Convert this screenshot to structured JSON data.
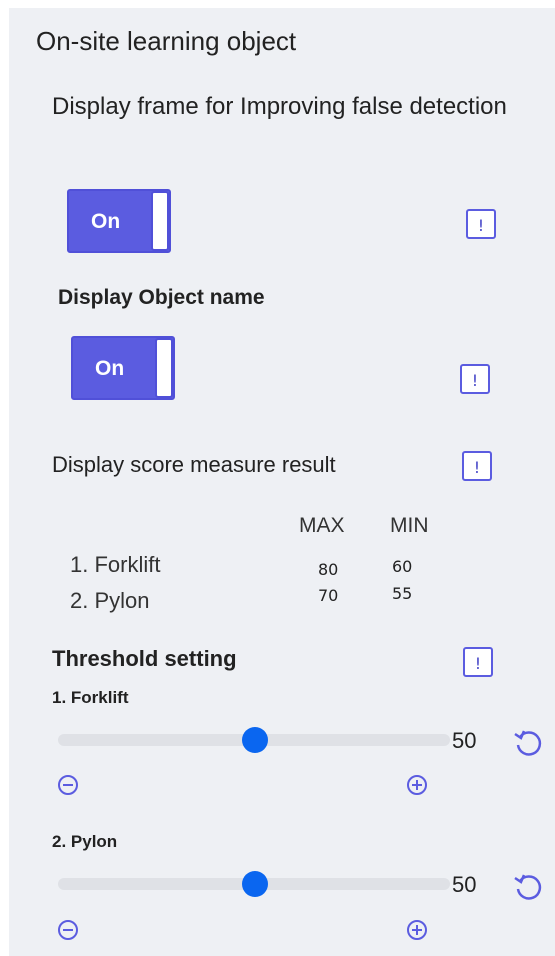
{
  "panel": {
    "title": "On-site learning object"
  },
  "false_detection": {
    "heading": "Display frame for Improving false detection",
    "toggle_label": "On",
    "info_symbol": "!"
  },
  "object_name": {
    "heading": "Display Object name",
    "toggle_label": "On",
    "info_symbol": "!"
  },
  "score": {
    "heading": "Display score measure result",
    "info_symbol": "!",
    "columns": [
      "MAX",
      "MIN"
    ],
    "rows": [
      {
        "name": "1. Forklift",
        "max": "80",
        "min": "60"
      },
      {
        "name": "2. Pylon",
        "max": "70",
        "min": "55"
      }
    ]
  },
  "threshold": {
    "heading": "Threshold setting",
    "info_symbol": "!",
    "sliders": [
      {
        "label": "1. Forklift",
        "value": "50",
        "fraction": 0.5
      },
      {
        "label": "2. Pylon",
        "value": "50",
        "fraction": 0.5
      }
    ]
  },
  "colors": {
    "accent": "#5b5ce0",
    "slider_thumb": "#0a66f0",
    "panel_bg": "#eef0f4"
  },
  "icons": [
    "info-icon",
    "reset-icon",
    "minus-icon",
    "plus-icon"
  ]
}
